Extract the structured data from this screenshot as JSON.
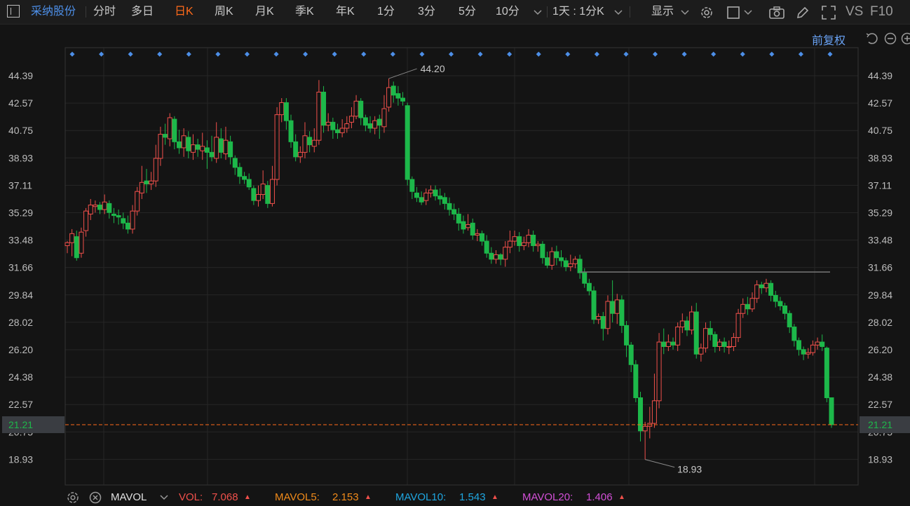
{
  "toolbar": {
    "stock_name": "采纳股份",
    "tabs": [
      "分时",
      "多日",
      "日K",
      "周K",
      "月K",
      "季K",
      "年K",
      "1分",
      "3分",
      "5分",
      "10分"
    ],
    "active_tab_index": 2,
    "period_select": "1天 : 1分K",
    "display_label": "显示",
    "vs_label": "VS",
    "f10_label": "F10"
  },
  "subbar": {
    "adjust_label": "前复权"
  },
  "colors": {
    "up": "#f0504b",
    "down": "#1db84a",
    "accent": "#ff6a1a",
    "marker": "#4d8fe8"
  },
  "chart_data": {
    "type": "candlestick",
    "y_ticks": [
      "44.39",
      "42.57",
      "40.75",
      "38.93",
      "37.11",
      "35.29",
      "33.48",
      "31.66",
      "29.84",
      "28.02",
      "26.20",
      "24.38",
      "22.57",
      "20.75",
      "18.93"
    ],
    "ylim": [
      17.5,
      45.6
    ],
    "high_label": "44.20",
    "low_label": "18.93",
    "current_price": "21.21",
    "current_value": 21.21,
    "resistance_level": 31.35,
    "event_marker_count": 27,
    "candles": [
      [
        33.1,
        33.3,
        32.6,
        33.4
      ],
      [
        33.3,
        33.9,
        32.4,
        34.2
      ],
      [
        33.7,
        32.3,
        32.1,
        34.1
      ],
      [
        32.6,
        34.0,
        32.3,
        34.3
      ],
      [
        34.1,
        35.4,
        33.7,
        35.6
      ],
      [
        35.2,
        35.8,
        34.8,
        36.2
      ],
      [
        35.7,
        35.8,
        35.3,
        36.1
      ],
      [
        35.8,
        35.5,
        35.2,
        36.0
      ],
      [
        35.5,
        36.0,
        35.2,
        36.5
      ],
      [
        35.9,
        35.3,
        34.9,
        36.1
      ],
      [
        35.2,
        35.1,
        34.6,
        35.6
      ],
      [
        35.1,
        35.0,
        34.5,
        35.5
      ],
      [
        34.9,
        34.6,
        34.2,
        35.3
      ],
      [
        34.6,
        34.2,
        33.9,
        35.1
      ],
      [
        34.2,
        35.4,
        33.9,
        35.8
      ],
      [
        35.4,
        36.7,
        35.1,
        37.0
      ],
      [
        36.6,
        37.3,
        36.2,
        38.4
      ],
      [
        37.4,
        37.2,
        36.6,
        38.2
      ],
      [
        37.2,
        37.4,
        36.8,
        38.0
      ],
      [
        37.4,
        38.9,
        37.0,
        39.8
      ],
      [
        38.9,
        40.5,
        38.4,
        41.0
      ],
      [
        40.5,
        40.3,
        39.8,
        41.2
      ],
      [
        40.2,
        41.6,
        39.7,
        41.9
      ],
      [
        41.5,
        40.0,
        39.5,
        41.7
      ],
      [
        40.0,
        39.6,
        39.2,
        40.8
      ],
      [
        39.6,
        40.4,
        39.0,
        40.9
      ],
      [
        40.3,
        39.4,
        38.9,
        40.7
      ],
      [
        39.3,
        39.8,
        38.8,
        40.5
      ],
      [
        39.8,
        39.5,
        39.0,
        40.2
      ],
      [
        39.4,
        39.7,
        38.8,
        40.6
      ],
      [
        39.6,
        39.3,
        38.2,
        40.1
      ],
      [
        39.3,
        39.0,
        38.7,
        40.4
      ],
      [
        38.9,
        40.3,
        38.6,
        41.3
      ],
      [
        40.2,
        39.3,
        38.9,
        40.9
      ],
      [
        39.2,
        40.1,
        38.8,
        41.0
      ],
      [
        40.0,
        39.0,
        38.5,
        40.4
      ],
      [
        38.9,
        38.3,
        37.8,
        39.1
      ],
      [
        38.3,
        37.7,
        37.2,
        38.6
      ],
      [
        37.7,
        37.5,
        37.2,
        38.0
      ],
      [
        37.5,
        37.0,
        36.8,
        37.9
      ],
      [
        36.9,
        36.1,
        35.8,
        37.1
      ],
      [
        36.1,
        36.5,
        35.7,
        37.1
      ],
      [
        36.5,
        37.2,
        36.2,
        38.1
      ],
      [
        37.1,
        35.9,
        35.6,
        37.4
      ],
      [
        35.9,
        37.5,
        35.7,
        38.4
      ],
      [
        37.5,
        41.8,
        37.1,
        42.3
      ],
      [
        41.8,
        42.6,
        41.3,
        42.9
      ],
      [
        42.6,
        41.4,
        40.8,
        42.9
      ],
      [
        41.4,
        40.0,
        39.6,
        41.8
      ],
      [
        40.0,
        39.0,
        38.7,
        40.5
      ],
      [
        39.0,
        39.3,
        38.6,
        39.7
      ],
      [
        39.3,
        40.4,
        38.9,
        41.3
      ],
      [
        40.3,
        39.8,
        39.3,
        40.7
      ],
      [
        39.7,
        40.1,
        39.3,
        40.9
      ],
      [
        40.1,
        43.3,
        39.8,
        44.1
      ],
      [
        43.3,
        41.1,
        40.6,
        43.7
      ],
      [
        41.1,
        41.3,
        40.7,
        41.9
      ],
      [
        41.3,
        40.8,
        40.2,
        41.6
      ],
      [
        40.8,
        40.6,
        40.2,
        41.2
      ],
      [
        40.6,
        40.9,
        40.3,
        41.5
      ],
      [
        40.9,
        41.2,
        40.6,
        41.7
      ],
      [
        41.3,
        41.7,
        40.9,
        42.3
      ],
      [
        41.7,
        42.7,
        41.5,
        43.1
      ],
      [
        42.7,
        41.6,
        41.1,
        42.9
      ],
      [
        41.6,
        41.1,
        40.7,
        41.8
      ],
      [
        41.2,
        40.9,
        40.6,
        41.7
      ],
      [
        40.9,
        41.4,
        40.5,
        41.7
      ],
      [
        41.5,
        41.1,
        40.2,
        41.8
      ],
      [
        41.0,
        42.2,
        40.6,
        43.1
      ],
      [
        42.3,
        43.6,
        42.0,
        44.2
      ],
      [
        43.7,
        43.1,
        42.6,
        44.0
      ],
      [
        43.2,
        42.9,
        42.4,
        43.7
      ],
      [
        42.9,
        42.7,
        42.4,
        43.3
      ],
      [
        42.4,
        37.5,
        37.1,
        42.6
      ],
      [
        37.5,
        36.7,
        36.2,
        37.7
      ],
      [
        36.6,
        36.3,
        36.0,
        37.0
      ],
      [
        36.3,
        36.0,
        35.8,
        36.7
      ],
      [
        36.1,
        36.6,
        35.8,
        36.9
      ],
      [
        36.6,
        36.8,
        36.3,
        37.1
      ],
      [
        36.8,
        36.4,
        36.1,
        37.1
      ],
      [
        36.4,
        36.2,
        35.8,
        36.9
      ],
      [
        36.3,
        35.9,
        35.5,
        36.6
      ],
      [
        35.9,
        35.5,
        35.1,
        36.3
      ],
      [
        35.5,
        35.2,
        34.8,
        35.9
      ],
      [
        35.2,
        34.6,
        34.1,
        35.6
      ],
      [
        34.7,
        34.2,
        33.9,
        35.1
      ],
      [
        34.3,
        34.5,
        34.1,
        35.2
      ],
      [
        34.6,
        33.8,
        33.5,
        34.9
      ],
      [
        33.8,
        33.9,
        33.4,
        34.2
      ],
      [
        33.9,
        33.4,
        33.1,
        34.1
      ],
      [
        33.4,
        32.6,
        32.3,
        33.8
      ],
      [
        32.6,
        32.2,
        31.9,
        33.0
      ],
      [
        32.2,
        32.5,
        31.9,
        32.8
      ],
      [
        32.5,
        32.2,
        31.8,
        32.6
      ],
      [
        32.2,
        33.0,
        31.7,
        33.4
      ],
      [
        33.0,
        33.4,
        32.6,
        34.1
      ],
      [
        33.4,
        33.7,
        33.1,
        34.1
      ],
      [
        33.7,
        33.1,
        32.7,
        34.0
      ],
      [
        33.1,
        33.3,
        32.8,
        33.7
      ],
      [
        33.3,
        33.8,
        33.0,
        34.2
      ],
      [
        33.8,
        33.1,
        32.7,
        34.1
      ],
      [
        33.1,
        33.2,
        32.7,
        33.4
      ],
      [
        33.2,
        32.3,
        31.9,
        33.4
      ],
      [
        32.3,
        31.8,
        31.6,
        32.7
      ],
      [
        31.8,
        32.7,
        31.5,
        33.0
      ],
      [
        32.7,
        32.3,
        31.8,
        33.1
      ],
      [
        32.3,
        32.1,
        31.7,
        32.8
      ],
      [
        32.1,
        31.7,
        31.4,
        32.3
      ],
      [
        31.7,
        31.9,
        31.4,
        32.5
      ],
      [
        31.9,
        32.2,
        31.6,
        32.4
      ],
      [
        32.2,
        31.3,
        30.9,
        32.5
      ],
      [
        31.3,
        30.6,
        30.3,
        31.6
      ],
      [
        30.6,
        30.1,
        29.8,
        30.9
      ],
      [
        30.1,
        28.2,
        27.9,
        30.4
      ],
      [
        28.2,
        28.4,
        27.9,
        28.6
      ],
      [
        28.4,
        27.6,
        26.8,
        28.7
      ],
      [
        27.6,
        29.4,
        27.2,
        29.8
      ],
      [
        29.4,
        28.6,
        28.0,
        30.8
      ],
      [
        28.6,
        29.5,
        27.9,
        29.9
      ],
      [
        29.5,
        27.8,
        27.3,
        29.8
      ],
      [
        27.8,
        26.5,
        25.7,
        28.1
      ],
      [
        26.5,
        25.2,
        24.7,
        26.7
      ],
      [
        25.2,
        23.0,
        22.7,
        25.5
      ],
      [
        23.0,
        20.8,
        20.1,
        23.4
      ],
      [
        20.8,
        21.1,
        18.9,
        21.4
      ],
      [
        21.1,
        21.3,
        20.3,
        22.4
      ],
      [
        21.3,
        22.8,
        21.0,
        24.6
      ],
      [
        22.8,
        26.7,
        22.3,
        27.3
      ],
      [
        26.7,
        26.4,
        25.9,
        27.6
      ],
      [
        26.4,
        26.7,
        26.1,
        27.2
      ],
      [
        26.7,
        26.5,
        26.2,
        27.0
      ],
      [
        26.5,
        27.7,
        26.1,
        28.0
      ],
      [
        27.7,
        28.1,
        27.3,
        28.6
      ],
      [
        28.1,
        27.5,
        27.1,
        28.4
      ],
      [
        27.5,
        28.7,
        27.2,
        29.1
      ],
      [
        28.7,
        25.9,
        25.6,
        29.3
      ],
      [
        25.9,
        26.3,
        25.4,
        26.6
      ],
      [
        26.3,
        27.6,
        26.0,
        28.0
      ],
      [
        27.6,
        27.2,
        26.8,
        28.1
      ],
      [
        27.2,
        26.4,
        26.0,
        27.4
      ],
      [
        26.4,
        26.7,
        26.1,
        26.9
      ],
      [
        26.7,
        26.4,
        26.0,
        27.0
      ],
      [
        26.4,
        26.4,
        25.9,
        26.8
      ],
      [
        26.4,
        27.0,
        26.1,
        27.3
      ],
      [
        27.0,
        28.6,
        26.7,
        28.9
      ],
      [
        28.6,
        29.2,
        28.3,
        29.6
      ],
      [
        29.2,
        28.9,
        28.5,
        29.7
      ],
      [
        28.9,
        29.6,
        28.7,
        30.0
      ],
      [
        29.6,
        30.5,
        29.3,
        30.8
      ],
      [
        30.5,
        30.3,
        29.9,
        30.7
      ],
      [
        30.3,
        30.6,
        30.0,
        30.9
      ],
      [
        30.6,
        29.8,
        29.4,
        30.8
      ],
      [
        29.8,
        29.4,
        29.0,
        30.1
      ],
      [
        29.4,
        29.1,
        28.8,
        29.7
      ],
      [
        29.1,
        28.6,
        28.2,
        29.3
      ],
      [
        28.6,
        27.7,
        27.3,
        28.8
      ],
      [
        27.7,
        26.8,
        26.4,
        27.9
      ],
      [
        26.8,
        26.2,
        25.8,
        27.0
      ],
      [
        26.2,
        25.9,
        25.5,
        26.4
      ],
      [
        25.9,
        26.0,
        25.6,
        26.3
      ],
      [
        26.0,
        26.5,
        25.8,
        26.8
      ],
      [
        26.5,
        26.7,
        26.2,
        27.0
      ],
      [
        26.7,
        26.4,
        26.1,
        27.2
      ],
      [
        26.3,
        23.0,
        22.7,
        26.4
      ],
      [
        23.0,
        21.21,
        21.0,
        23.0
      ]
    ]
  },
  "indicator": {
    "name": "MAVOL",
    "vol_label": "VOL:",
    "vol_value": "7.068",
    "mavol5_label": "MAVOL5:",
    "mavol5_value": "2.153",
    "mavol10_label": "MAVOL10:",
    "mavol10_value": "1.543",
    "mavol20_label": "MAVOL20:",
    "mavol20_value": "1.406",
    "up_arrow": "▲"
  }
}
